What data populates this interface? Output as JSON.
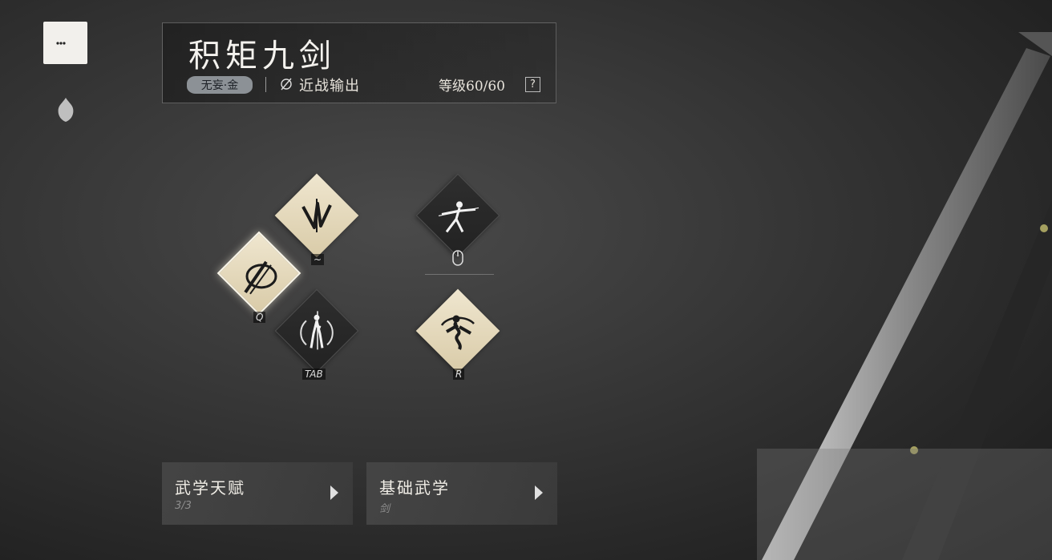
{
  "sidebar": {
    "active_icon": "crescent-dots-icon",
    "secondary_icon": "flame-emblem-icon"
  },
  "header": {
    "title": "积矩九剑",
    "element_tag": "无妄·金",
    "role_icon": "slashed-circle-icon",
    "role_label": "近战输出",
    "level": "等级60/60",
    "help_label": "?"
  },
  "skills": [
    {
      "name": "upper-skill",
      "icon": "sword-strokes-icon",
      "key": "~"
    },
    {
      "name": "left-skill",
      "icon": "sword-slash-icon",
      "key": "Q"
    },
    {
      "name": "bottom-skill",
      "icon": "sword-stance-icon",
      "key": "TAB"
    },
    {
      "name": "attack-skill",
      "icon": "lunge-figure-icon",
      "key": "mouse-icon"
    },
    {
      "name": "ultimate-skill",
      "icon": "spin-figure-icon",
      "key": "R"
    }
  ],
  "menu": {
    "talent": {
      "title": "武学天赋",
      "sub": "3/3"
    },
    "basic": {
      "title": "基础武学",
      "sub": "剑"
    }
  },
  "colors": {
    "diamond_light": "#efe6cf",
    "diamond_dark": "#2a2a2a",
    "tag_bg": "#8c9196"
  }
}
